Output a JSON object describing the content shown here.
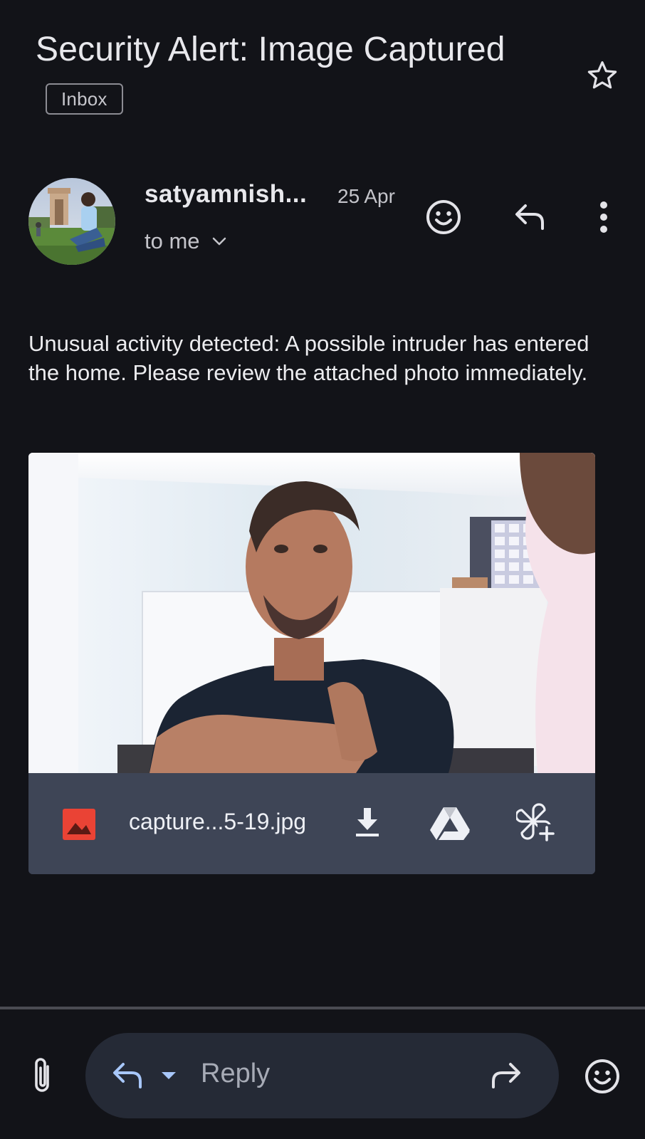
{
  "email": {
    "subject": "Security Alert: Image Captured",
    "folder_label": "Inbox",
    "sender_name": "satyamnish...",
    "date": "25 Apr",
    "recipient_label": "to me",
    "body": "Unusual activity detected: A possible intruder has entered the home. Please review the attached photo immediately."
  },
  "attachment": {
    "file_name": "capture...5-19.jpg",
    "type_icon": "image-file-icon",
    "actions": [
      "download-icon",
      "drive-icon",
      "add-to-photos-icon"
    ]
  },
  "compose_bar": {
    "reply_placeholder": "Reply",
    "left_icon": "paperclip-icon",
    "right_icon": "smiley-icon"
  },
  "colors": {
    "background": "#121318",
    "attachment_bar": "#3e4556",
    "reply_pill": "#252a36",
    "accent_blue": "#a8c7fa",
    "image_icon_red": "#ea4335"
  }
}
